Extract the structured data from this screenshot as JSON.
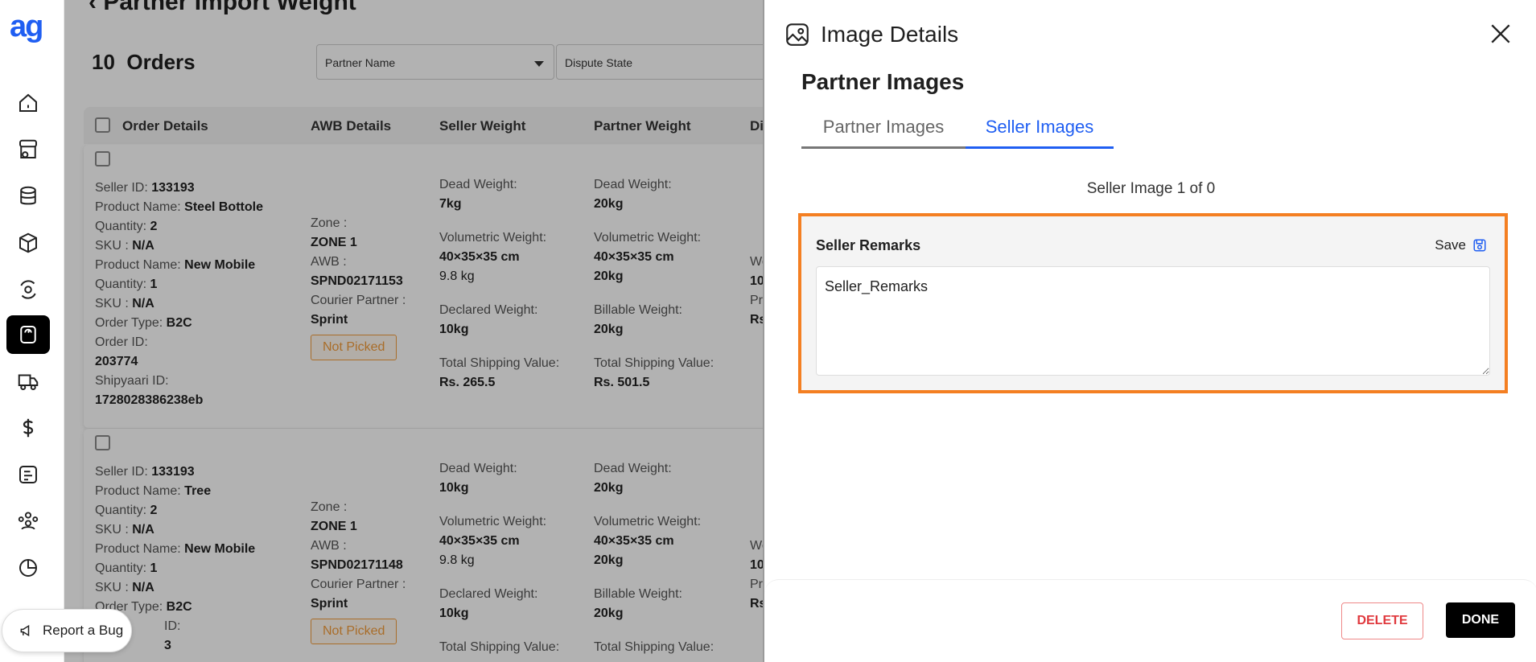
{
  "sidebar": {
    "logo_text": "ag",
    "items": [
      {
        "icon": "home-icon"
      },
      {
        "icon": "store-icon"
      },
      {
        "icon": "database-icon"
      },
      {
        "icon": "box-icon"
      },
      {
        "icon": "settings-cycle-icon"
      },
      {
        "icon": "weight-icon",
        "active": true
      },
      {
        "icon": "truck-icon"
      },
      {
        "icon": "dollar-icon"
      },
      {
        "icon": "invoice-icon"
      },
      {
        "icon": "team-icon"
      },
      {
        "icon": "pie-chart-icon"
      }
    ],
    "bug_label": "Report a Bug"
  },
  "main": {
    "title": "Partner Import Weight",
    "orders_count": "10",
    "orders_label": "Orders",
    "filters": {
      "partner_name": "Partner Name",
      "dispute_state": "Dispute State"
    },
    "columns": [
      "Order Details",
      "AWB Details",
      "Seller Weight",
      "Partner Weight",
      "Di"
    ],
    "orders": [
      {
        "seller_id": "133193",
        "product1": "Steel Bottole",
        "qty1": "2",
        "sku1": "N/A",
        "product2": "New Mobile",
        "qty2": "1",
        "sku2": "N/A",
        "order_type": "B2C",
        "order_id": "203774",
        "shipyaari_id": "1728028386238eb",
        "zone": "ZONE 1",
        "awb": "SPND02171153",
        "courier": "Sprint",
        "status": "Not Picked",
        "seller_dead": "7kg",
        "seller_vol1": "40×35×35 cm",
        "seller_vol2": "9.8 kg",
        "seller_declared": "10kg",
        "seller_ship": "Rs. 265.5",
        "partner_dead": "20kg",
        "partner_vol1": "40×35×35 cm",
        "partner_vol2": "20kg",
        "partner_billable": "20kg",
        "partner_ship": "Rs. 501.5"
      },
      {
        "seller_id": "133193",
        "product1": "Tree",
        "qty1": "2",
        "sku1": "N/A",
        "product2": "New Mobile",
        "qty2": "1",
        "sku2": "N/A",
        "order_type": "B2C",
        "order_id_partial": "ID:",
        "order_id_rest": "3",
        "zone": "ZONE 1",
        "awb": "SPND02171148",
        "courier": "Sprint",
        "status": "Not Picked",
        "seller_dead": "10kg",
        "seller_vol1": "40×35×35 cm",
        "seller_vol2": "9.8 kg",
        "seller_declared": "10kg",
        "partner_dead": "20kg",
        "partner_vol1": "40×35×35 cm",
        "partner_vol2": "20kg",
        "partner_billable": "20kg"
      }
    ],
    "labels": {
      "seller_id": "Seller ID:",
      "product_name": "Product Name:",
      "quantity": "Quantity:",
      "sku": "SKU :",
      "order_type": "Order Type:",
      "order_id": "Order ID:",
      "shipyaari_id": "Shipyaari ID:",
      "zone": "Zone :",
      "awb": "AWB :",
      "courier": "Courier Partner :",
      "dead": "Dead Weight:",
      "volumetric": "Volumetric Weight:",
      "declared": "Declared Weight:",
      "billable": "Billable Weight:",
      "total_ship": "Total Shipping Value:",
      "we": "We",
      "ten": "10",
      "pr": "Pr",
      "rs": "Rs"
    }
  },
  "drawer": {
    "title": "Image Details",
    "section_title": "Partner Images",
    "tabs": [
      "Partner Images",
      "Seller Images"
    ],
    "active_tab": "Seller Images",
    "counter": "Seller Image 1 of 0",
    "remarks_label": "Seller Remarks",
    "save_label": "Save",
    "remarks_value": "Seller_Remarks",
    "delete_label": "DELETE",
    "done_label": "DONE",
    "highlight_color": "#f47f22",
    "accent_color": "#1f5ef2"
  }
}
